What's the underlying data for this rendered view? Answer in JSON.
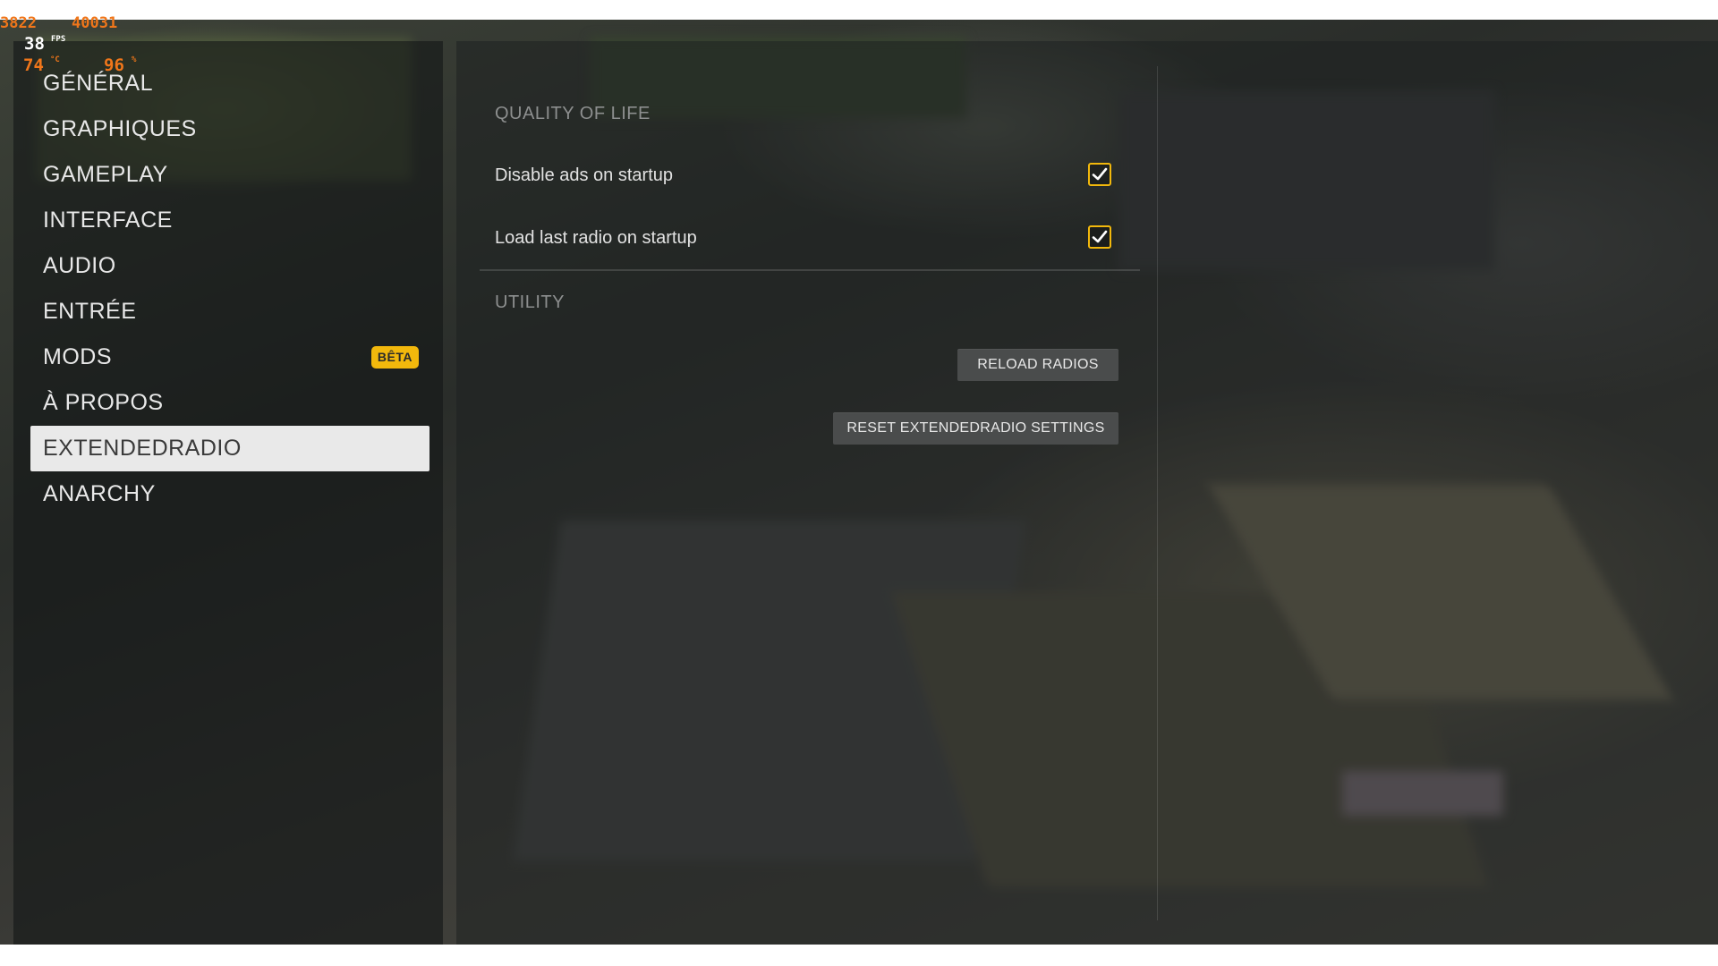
{
  "overlay": {
    "line1_a": "3822",
    "line1_b": "40031",
    "fps_value": "38",
    "fps_unit": "FPS",
    "temp_value": "74",
    "temp_unit": "°C",
    "usage_value": "96",
    "usage_unit": "%"
  },
  "sidebar": {
    "items": [
      {
        "label": "GÉNÉRAL"
      },
      {
        "label": "GRAPHIQUES"
      },
      {
        "label": "GAMEPLAY"
      },
      {
        "label": "INTERFACE"
      },
      {
        "label": "AUDIO"
      },
      {
        "label": "ENTRÉE"
      },
      {
        "label": "MODS",
        "badge": "BÊTA"
      },
      {
        "label": "À PROPOS"
      },
      {
        "label": "EXTENDEDRADIO",
        "active": true
      },
      {
        "label": "ANARCHY"
      }
    ]
  },
  "main": {
    "quality_of_life": {
      "title": "QUALITY OF LIFE",
      "settings": [
        {
          "label": "Disable ads on startup",
          "checked": true
        },
        {
          "label": "Load last radio on startup",
          "checked": true
        }
      ]
    },
    "utility": {
      "title": "UTILITY",
      "reload_button": "RELOAD RADIOS",
      "reset_button": "RESET EXTENDEDRADIO SETTINGS"
    }
  },
  "colors": {
    "accent": "#f2b80c",
    "overlay_orange": "#f0761a",
    "active_item_bg": "#e9e9e9"
  }
}
